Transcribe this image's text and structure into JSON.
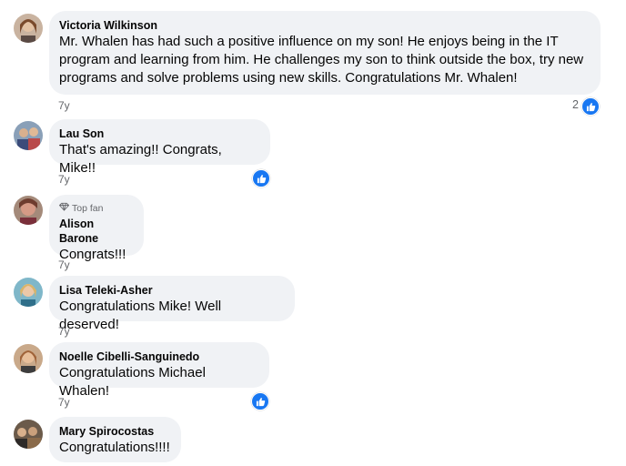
{
  "comments": [
    {
      "name": "Victoria Wilkinson",
      "lines": [
        "Mr. Whalen has had such a positive influence on my son! He enjoys being in the IT",
        "program and learning from him. He challenges my son to think outside the box, try new",
        "programs and solve problems using new skills. Congratulations Mr. Whalen!"
      ],
      "time": "7y",
      "like_count": "2"
    },
    {
      "name": "Lau Son",
      "lines": [
        "That's amazing!! Congrats, Mike!!"
      ],
      "time": "7y"
    },
    {
      "badge": "Top fan",
      "name": "Alison Barone",
      "lines": [
        "Congrats!!!"
      ],
      "time": "7y"
    },
    {
      "name": "Lisa Teleki-Asher",
      "lines": [
        "Congratulations Mike! Well deserved!"
      ],
      "time": "7y"
    },
    {
      "name": "Noelle Cibelli-Sanguinedo",
      "lines": [
        "Congratulations Michael Whalen!"
      ],
      "time": "7y"
    },
    {
      "name": "Mary Spirocostas",
      "lines": [
        "Congratulations!!!!"
      ]
    }
  ],
  "colors": {
    "bubble": "#f0f2f5",
    "muted_text": "#65676b",
    "like_blue": "#1877f2"
  },
  "icons": {
    "like": "thumbs-up-icon",
    "top_fan": "diamond-icon"
  }
}
